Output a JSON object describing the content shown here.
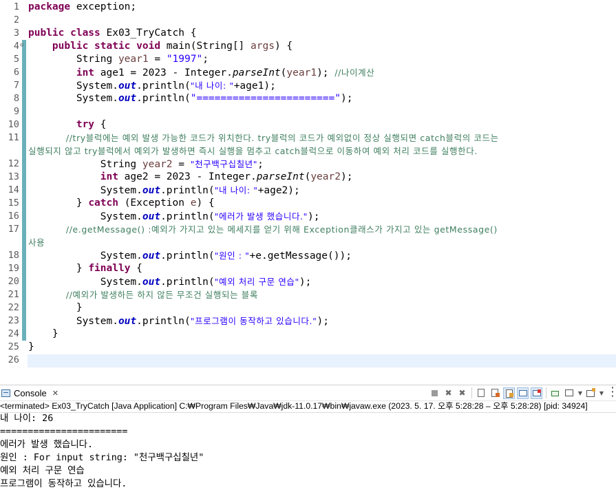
{
  "editor": {
    "line_numbers": [
      "1",
      "2",
      "3",
      "4",
      "5",
      "6",
      "7",
      "8",
      "9",
      "10",
      "11",
      "12",
      "13",
      "14",
      "15",
      "16",
      "17",
      "18",
      "19",
      "20",
      "21",
      "22",
      "23",
      "24",
      "25",
      "26"
    ],
    "fold_glyph": "⊖",
    "code": {
      "l1_kw": "package",
      "l1_t": " exception;",
      "l3_kw": "public class",
      "l3_t": " Ex03_TryCatch {",
      "l4_kw": "    public static void",
      "l4_t1": " main(String[] ",
      "l4_var": "args",
      "l4_t2": ") {",
      "l5_t1": "        String ",
      "l5_var": "year1",
      "l5_t2": " = ",
      "l5_str": "\"1997\"",
      "l5_t3": ";",
      "l6_kw": "        int",
      "l6_t1": " age1 = 2023 - Integer.",
      "l6_m": "parseInt",
      "l6_t2": "(",
      "l6_var": "year1",
      "l6_t3": "); ",
      "l6_cm": "//나이계산",
      "l7_t1": "        System.",
      "l7_f": "out",
      "l7_t2": ".println(",
      "l7_str": "\"내 나이: \"",
      "l7_t3": "+age1);",
      "l8_t1": "        System.",
      "l8_f": "out",
      "l8_t2": ".println(",
      "l8_str": "\"=======================\"",
      "l8_t3": ");",
      "l10_kw": "        try",
      "l10_t": " {",
      "l11_cm1": "            //try블럭에는 예외 발생 가능한 코드가 위치한다. try블럭의 코드가 예외없이 정상 실행되면 catch블럭의 코드는",
      "l11_cm2": "실행되지 않고 try블럭에서 예외가 발생하면 즉시 실행을 멈추고 catch블럭으로 이동하여 예외 처리 코드를 실행한다.",
      "l12_t1": "            String ",
      "l12_var": "year2",
      "l12_t2": " = ",
      "l12_str": "\"천구백구십칠년\"",
      "l12_t3": ";",
      "l13_kw": "            int",
      "l13_t1": " age2 = 2023 - Integer.",
      "l13_m": "parseInt",
      "l13_t2": "(",
      "l13_var": "year2",
      "l13_t3": ");",
      "l14_t1": "            System.",
      "l14_f": "out",
      "l14_t2": ".println(",
      "l14_str": "\"내 나이: \"",
      "l14_t3": "+age2);",
      "l15_t1": "        } ",
      "l15_kw": "catch",
      "l15_t2": " (Exception ",
      "l15_var": "e",
      "l15_t3": ") {",
      "l16_t1": "            System.",
      "l16_f": "out",
      "l16_t2": ".println(",
      "l16_str": "\"에러가 발생 했습니다.\"",
      "l16_t3": ");",
      "l17_cm1": "            //e.getMessage() :예외가 가지고 있는 메세지를 얻기 위해 Exception클래스가 가지고 있는 getMessage()",
      "l17_cm2": "사용",
      "l18_t1": "            System.",
      "l18_f": "out",
      "l18_t2": ".println(",
      "l18_str": "\"원인 : \"",
      "l18_t3": "+e.getMessage());",
      "l19_t1": "        } ",
      "l19_kw": "finally",
      "l19_t2": " {",
      "l20_t1": "            System.",
      "l20_f": "out",
      "l20_t2": ".println(",
      "l20_str": "\"예외 처리 구문 연습\"",
      "l20_t3": ");",
      "l21_cm": "            //예외가 발생하든 하지 않든 무조건 실행되는 블록",
      "l22_t": "        }",
      "l23_t1": "        System.",
      "l23_f": "out",
      "l23_t2": ".println(",
      "l23_str": "\"프로그램이 동작하고 있습니다.\"",
      "l23_t3": ");",
      "l24_t": "    }",
      "l25_t": "}"
    }
  },
  "console": {
    "tab_label": "Console",
    "close_glyph": "✕",
    "status_line": "<terminated> Ex03_TryCatch [Java Application] C:₩Program Files₩Java₩jdk-11.0.17₩bin₩javaw.exe  (2023. 5. 17. 오후 5:28:28 – 오후 5:28:28) [pid: 34924]",
    "output": [
      "내 나이: 26",
      "=======================",
      "에러가 발생 했습니다.",
      "원인 : For input string: \"천구백구십칠년\"",
      "예외 처리 구문 연습",
      "프로그램이 동작하고 있습니다."
    ]
  },
  "toolbar_icons": [
    "terminate-icon",
    "remove-launch-icon",
    "remove-all-icon",
    "clear-console-icon",
    "scroll-lock-icon",
    "word-wrap-icon",
    "show-on-stdout-icon",
    "show-on-stderr-icon",
    "pin-console-icon",
    "display-console-icon",
    "dropdown-icon",
    "open-console-icon",
    "dropdown-icon",
    "view-menu-icon"
  ],
  "colors": {
    "keyword": "#7f0055",
    "string": "#2a00ff",
    "comment": "#3f7f5f",
    "field": "#0000c0",
    "local_var": "#6a3e3e",
    "current_line": "#e8f2fe"
  }
}
